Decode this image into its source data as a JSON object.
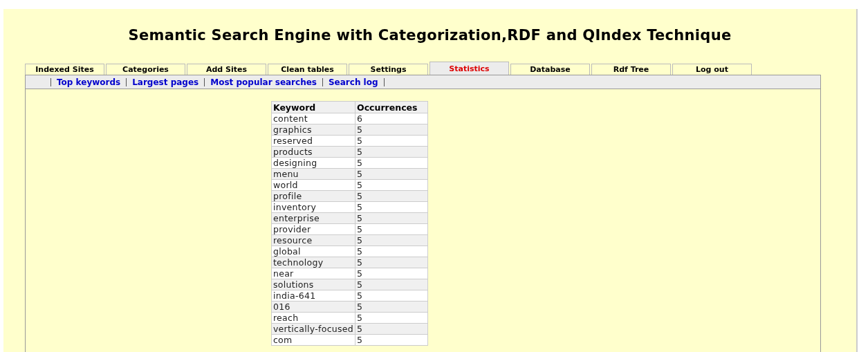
{
  "title": "Semantic Search Engine with Categorization,RDF and QIndex Technique",
  "tabs": [
    {
      "label": "Indexed Sites",
      "selected": false
    },
    {
      "label": "Categories",
      "selected": false
    },
    {
      "label": "Add Sites",
      "selected": false
    },
    {
      "label": "Clean tables",
      "selected": false
    },
    {
      "label": "Settings",
      "selected": false
    },
    {
      "label": "Statistics",
      "selected": true
    },
    {
      "label": "Database",
      "selected": false
    },
    {
      "label": "Rdf Tree",
      "selected": false
    },
    {
      "label": "Log out",
      "selected": false
    }
  ],
  "subnav": [
    "Top keywords",
    "Largest pages",
    "Most popular searches",
    "Search log"
  ],
  "table": {
    "columns": [
      "Keyword",
      "Occurrences"
    ],
    "rows": [
      [
        "content",
        "6"
      ],
      [
        "graphics",
        "5"
      ],
      [
        "reserved",
        "5"
      ],
      [
        "products",
        "5"
      ],
      [
        "designing",
        "5"
      ],
      [
        "menu",
        "5"
      ],
      [
        "world",
        "5"
      ],
      [
        "profile",
        "5"
      ],
      [
        "inventory",
        "5"
      ],
      [
        "enterprise",
        "5"
      ],
      [
        "provider",
        "5"
      ],
      [
        "resource",
        "5"
      ],
      [
        "global",
        "5"
      ],
      [
        "technology",
        "5"
      ],
      [
        "near",
        "5"
      ],
      [
        "solutions",
        "5"
      ],
      [
        "india-641",
        "5"
      ],
      [
        "016",
        "5"
      ],
      [
        "reach",
        "5"
      ],
      [
        "vertically-focused",
        "5"
      ],
      [
        "com",
        "5"
      ]
    ]
  }
}
